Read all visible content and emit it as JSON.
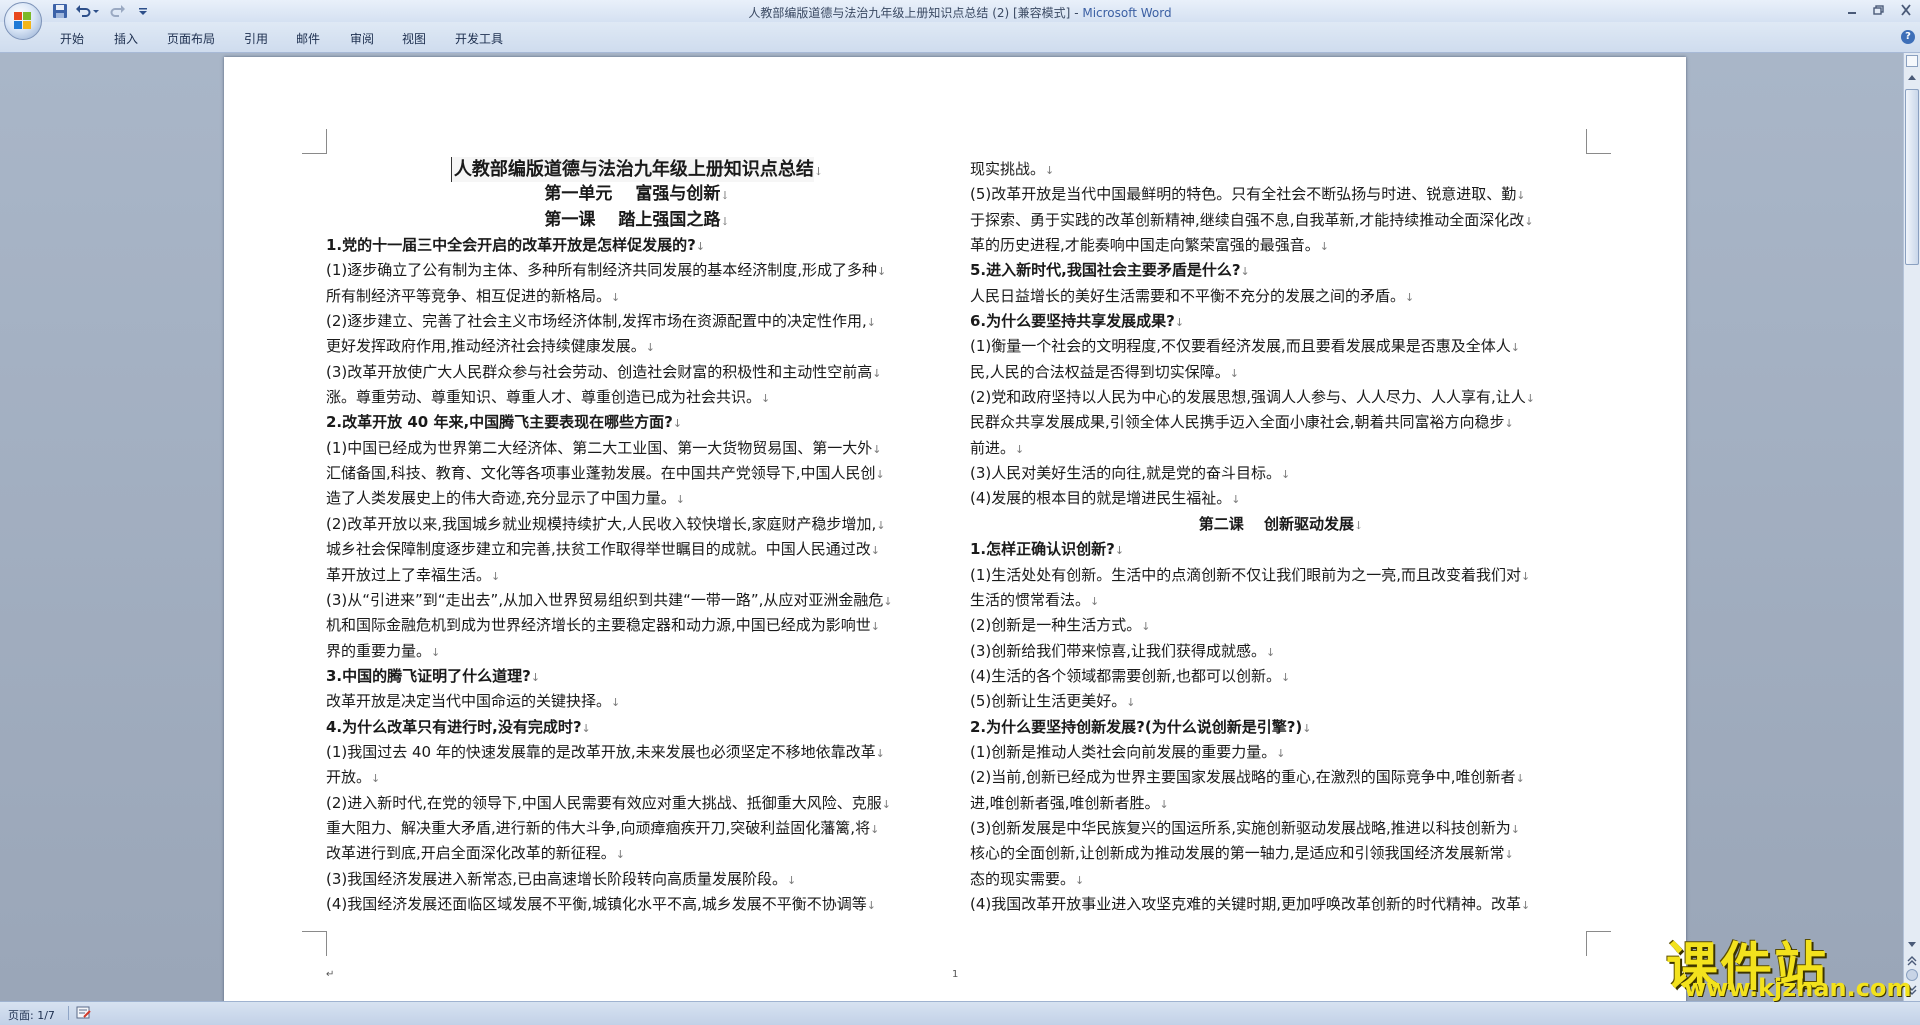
{
  "window": {
    "title_doc": "人教部编版道德与法治九年级上册知识点总结 (2) [兼容模式]",
    "title_sep": " - ",
    "title_app": "Microsoft Word"
  },
  "ribbon": {
    "tabs": [
      "开始",
      "插入",
      "页面布局",
      "引用",
      "邮件",
      "审阅",
      "视图",
      "开发工具"
    ]
  },
  "document": {
    "title": "人教部编版道德与法治九年级上册知识点总结",
    "unit": "第一单元　 富强与创新",
    "lesson1": "第一课　 踏上强国之路",
    "left_lines": [
      {
        "text": "1.党的十一届三中全会开启的改革开放是怎样促发展的?",
        "bold": true
      },
      {
        "text": "(1)逐步确立了公有制为主体、多种所有制经济共同发展的基本经济制度,形成了多种"
      },
      {
        "text": "所有制经济平等竞争、相互促进的新格局。"
      },
      {
        "text": "(2)逐步建立、完善了社会主义市场经济体制,发挥市场在资源配置中的决定性作用,"
      },
      {
        "text": "更好发挥政府作用,推动经济社会持续健康发展。"
      },
      {
        "text": "(3)改革开放使广大人民群众参与社会劳动、创造社会财富的积极性和主动性空前高"
      },
      {
        "text": "涨。尊重劳动、尊重知识、尊重人才、尊重创造已成为社会共识。"
      },
      {
        "text": "2.改革开放 40 年来,中国腾飞主要表现在哪些方面?",
        "bold": true
      },
      {
        "text": "(1)中国已经成为世界第二大经济体、第二大工业国、第一大货物贸易国、第一大外"
      },
      {
        "text": "汇储备国,科技、教育、文化等各项事业蓬勃发展。在中国共产党领导下,中国人民创"
      },
      {
        "text": "造了人类发展史上的伟大奇迹,充分显示了中国力量。"
      },
      {
        "text": "(2)改革开放以来,我国城乡就业规模持续扩大,人民收入较快增长,家庭财产稳步增加,"
      },
      {
        "text": "城乡社会保障制度逐步建立和完善,扶贫工作取得举世瞩目的成就。中国人民通过改"
      },
      {
        "text": "革开放过上了幸福生活。"
      },
      {
        "text": "(3)从“引进来”到“走出去”,从加入世界贸易组织到共建“一带一路”,从应对亚洲金融危"
      },
      {
        "text": "机和国际金融危机到成为世界经济增长的主要稳定器和动力源,中国已经成为影响世"
      },
      {
        "text": "界的重要力量。"
      },
      {
        "text": "3.中国的腾飞证明了什么道理?",
        "bold": true
      },
      {
        "text": "改革开放是决定当代中国命运的关键抉择。"
      },
      {
        "text": "4.为什么改革只有进行时,没有完成时?",
        "bold": true
      },
      {
        "text": "(1)我国过去 40 年的快速发展靠的是改革开放,未来发展也必须坚定不移地依靠改革"
      },
      {
        "text": "开放。"
      },
      {
        "text": "(2)进入新时代,在党的领导下,中国人民需要有效应对重大挑战、抵御重大风险、克服"
      },
      {
        "text": "重大阻力、解决重大矛盾,进行新的伟大斗争,向顽瘴痼疾开刀,突破利益固化藩篱,将"
      },
      {
        "text": "改革进行到底,开启全面深化改革的新征程。"
      },
      {
        "text": "(3)我国经济发展进入新常态,已由高速增长阶段转向高质量发展阶段。"
      },
      {
        "text": "(4)我国经济发展还面临区域发展不平衡,城镇化水平不高,城乡发展不平衡不协调等"
      }
    ],
    "right_lines": [
      {
        "text": "现实挑战。"
      },
      {
        "text": "(5)改革开放是当代中国最鲜明的特色。只有全社会不断弘扬与时进、锐意进取、勤"
      },
      {
        "text": "于探索、勇于实践的改革创新精神,继续自强不息,自我革新,才能持续推动全面深化改"
      },
      {
        "text": "革的历史进程,才能奏响中国走向繁荣富强的最强音。"
      },
      {
        "text": "5.进入新时代,我国社会主要矛盾是什么?",
        "bold": true
      },
      {
        "text": "人民日益增长的美好生活需要和不平衡不充分的发展之间的矛盾。"
      },
      {
        "text": "6.为什么要坚持共享发展成果?",
        "bold": true
      },
      {
        "text": "(1)衡量一个社会的文明程度,不仅要看经济发展,而且要看发展成果是否惠及全体人"
      },
      {
        "text": "民,人民的合法权益是否得到切实保障。"
      },
      {
        "text": "(2)党和政府坚持以人民为中心的发展思想,强调人人参与、人人尽力、人人享有,让人"
      },
      {
        "text": "民群众共享发展成果,引领全体人民携手迈入全面小康社会,朝着共同富裕方向稳步"
      },
      {
        "text": "前进。"
      },
      {
        "text": "(3)人民对美好生活的向往,就是党的奋斗目标。"
      },
      {
        "text": "(4)发展的根本目的就是增进民生福祉。"
      },
      {
        "text": "第二课　 创新驱动发展",
        "heading": true
      },
      {
        "text": "1.怎样正确认识创新?",
        "bold": true
      },
      {
        "text": "(1)生活处处有创新。生活中的点滴创新不仅让我们眼前为之一亮,而且改变着我们对"
      },
      {
        "text": "生活的惯常看法。"
      },
      {
        "text": "(2)创新是一种生活方式。"
      },
      {
        "text": "(3)创新给我们带来惊喜,让我们获得成就感。"
      },
      {
        "text": "(4)生活的各个领域都需要创新,也都可以创新。"
      },
      {
        "text": "(5)创新让生活更美好。"
      },
      {
        "text": "2.为什么要坚持创新发展?(为什么说创新是引擎?)",
        "bold": true
      },
      {
        "text": "(1)创新是推动人类社会向前发展的重要力量。"
      },
      {
        "text": "(2)当前,创新已经成为世界主要国家发展战略的重心,在激烈的国际竞争中,唯创新者"
      },
      {
        "text": "进,唯创新者强,唯创新者胜。"
      },
      {
        "text": "(3)创新发展是中华民族复兴的国运所系,实施创新驱动发展战略,推进以科技创新为"
      },
      {
        "text": "核心的全面创新,让创新成为推动发展的第一轴力,是适应和引领我国经济发展新常"
      },
      {
        "text": "态的现实需要。"
      },
      {
        "text": "(4)我国改革开放事业进入攻坚克难的关键时期,更加呼唤改革创新的时代精神。改革"
      }
    ],
    "paragraph_mark": "↓",
    "footer_mark": "↵",
    "page_number": "1"
  },
  "statusbar": {
    "page_count": "页面: 1/7"
  },
  "watermark": {
    "title": "课件站",
    "url": "www.kjzhan.com"
  },
  "colors": {
    "workspace_bg": "#9aa6b8",
    "ribbon_bg": "#d5e1f2",
    "watermark": "#f3e21d"
  }
}
